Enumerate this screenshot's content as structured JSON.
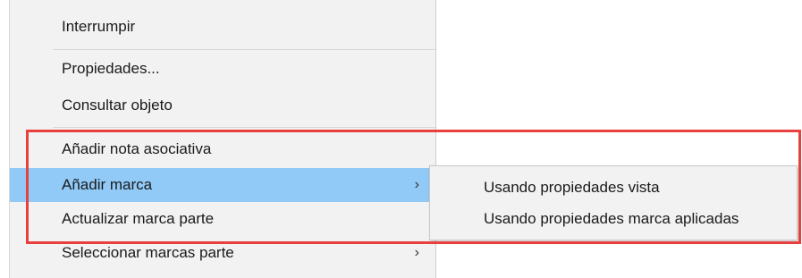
{
  "context_menu": {
    "items": [
      {
        "label": "Interrumpir"
      },
      {
        "label": "Propiedades..."
      },
      {
        "label": "Consultar objeto"
      },
      {
        "label": "Añadir nota asociativa"
      },
      {
        "label": "Añadir marca",
        "arrow": "›"
      },
      {
        "label": "Actualizar marca parte"
      },
      {
        "label": "Seleccionar marcas parte",
        "arrow": "›"
      }
    ]
  },
  "submenu": {
    "items": [
      {
        "label": "Usando propiedades vista"
      },
      {
        "label": "Usando propiedades marca aplicadas"
      }
    ]
  },
  "colors": {
    "highlight": "#91c9f7",
    "annotation_box": "#e8403f"
  }
}
